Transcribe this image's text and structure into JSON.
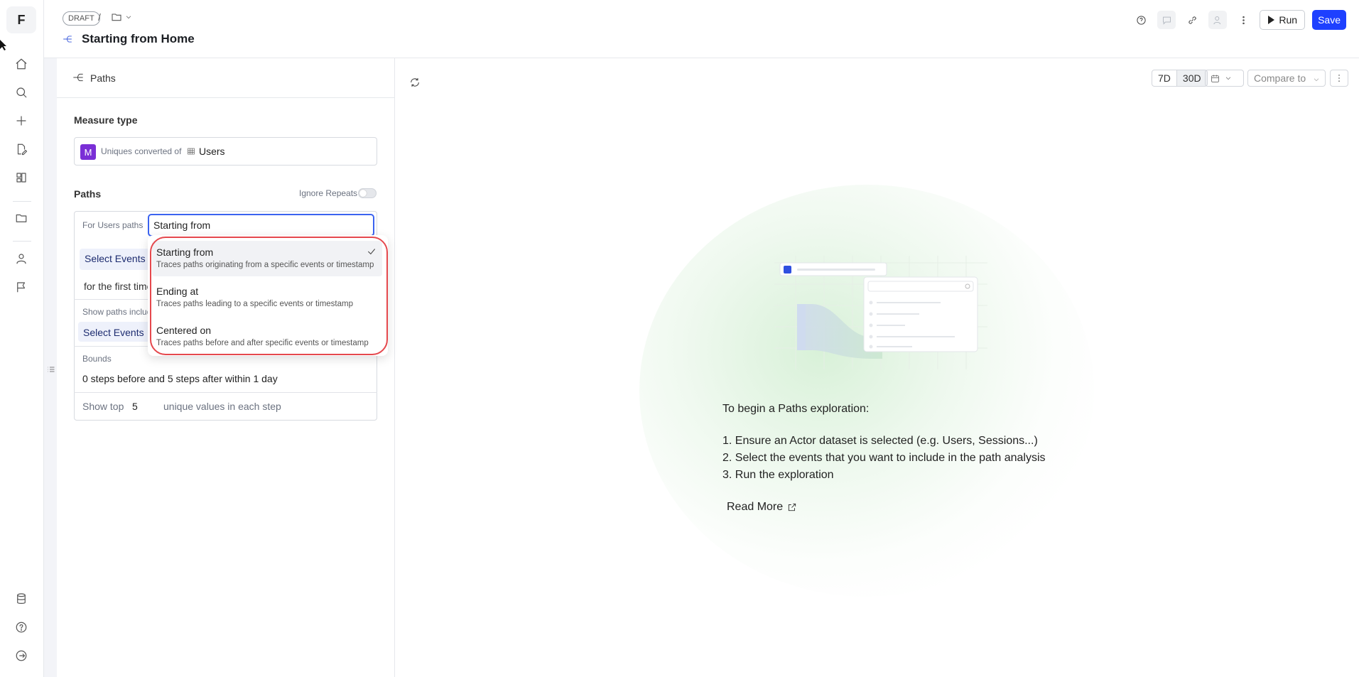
{
  "app": {
    "logo_letter": "F"
  },
  "header": {
    "draft_badge": "DRAFT",
    "crumb_sep": "/",
    "title": "Starting from Home",
    "run_label": "Run",
    "save_label": "Save"
  },
  "panel": {
    "title": "Paths",
    "measure_type_title": "Measure type",
    "measure_badge": "M",
    "measure_text": "Uniques converted of",
    "measure_dataset": "Users",
    "paths_title": "Paths",
    "ignore_repeats": "Ignore Repeats",
    "for_users_paths": "For Users paths",
    "path_mode_value": "Starting from",
    "select_events_1": "Select Events",
    "first_time": "for the first time",
    "show_paths_including": "Show paths including",
    "select_events_2": "Select Events",
    "bounds_label": "Bounds",
    "bounds_value": "0 steps before and 5 steps after within 1 day",
    "show_top": "Show top",
    "top_n": "5",
    "unique_values": "unique values in each step"
  },
  "dropdown": {
    "options": [
      {
        "label": "Starting from",
        "desc": "Traces paths originating from a specific events or timestamp"
      },
      {
        "label": "Ending at",
        "desc": "Traces paths leading to a specific events or timestamp"
      },
      {
        "label": "Centered on",
        "desc": "Traces paths before and after specific events or timestamp"
      }
    ]
  },
  "toolbar": {
    "range_7d": "7D",
    "range_30d": "30D",
    "compare_to": "Compare to"
  },
  "empty_state": {
    "intro": "To begin a Paths exploration:",
    "step1": "1. Ensure an Actor dataset is selected (e.g. Users, Sessions...)",
    "step2": "2. Select the events that you want to include in the path analysis",
    "step3": "3. Run the exploration",
    "read_more": "Read More"
  },
  "colors": {
    "primary": "#1e40ff",
    "measure_badge": "#7a2fd6",
    "highlight_ring": "#e5484d",
    "input_focus": "#3b63f0"
  }
}
